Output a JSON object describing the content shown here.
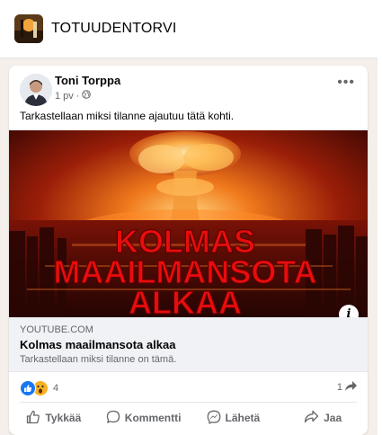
{
  "group": {
    "name": "TOTUUDENTORVI"
  },
  "post": {
    "author": "Toni Torppa",
    "time": "1 pv",
    "separator": "·",
    "text": "Tarkastellaan miksi tilanne ajautuu tätä kohti.",
    "image_text": [
      "KOLMAS",
      "MAAILMANSOTA",
      "ALKAA"
    ],
    "link": {
      "domain": "YOUTUBE.COM",
      "title": "Kolmas maailmansota alkaa",
      "description": "Tarkastellaan miksi tilanne on tämä."
    },
    "reaction_count": "4",
    "share_count": "1",
    "actions": {
      "like": "Tykkää",
      "comment": "Kommentti",
      "send": "Lähetä",
      "share": "Jaa"
    }
  },
  "icons": {
    "more": "more-options-icon",
    "privacy": "globe-icon",
    "info": "info-icon",
    "share": "share-arrow-icon",
    "like": "thumbs-up-icon",
    "comment": "comment-bubble-icon",
    "send": "messenger-icon"
  },
  "colors": {
    "like_blue": "#1877f2",
    "wow_yellow": "#f7b125",
    "image_text_red": "#e80d0d",
    "muted": "#65676b"
  }
}
